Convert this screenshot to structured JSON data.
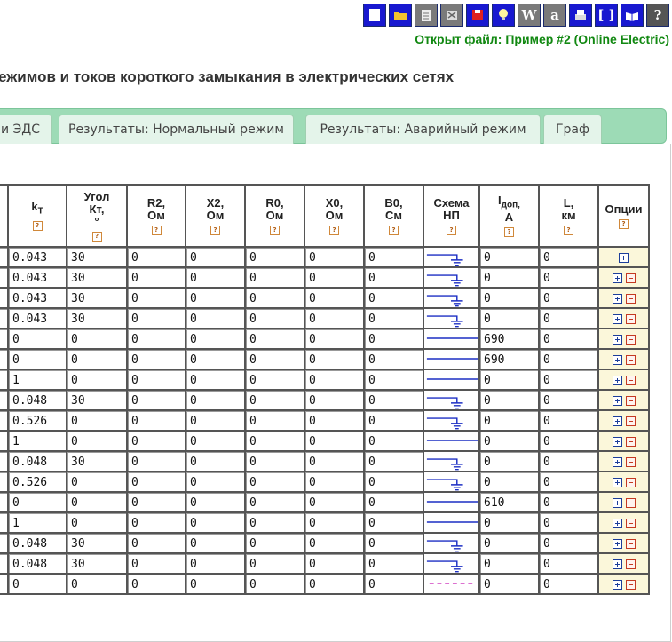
{
  "toolbar": {
    "buttons": [
      {
        "name": "new-file-icon",
        "color": "#1818d0"
      },
      {
        "name": "open-folder-icon",
        "color": "#1818d0"
      },
      {
        "name": "notepad-icon",
        "color": "#7a7a7a"
      },
      {
        "name": "close-file-icon",
        "color": "#7a7a7a"
      },
      {
        "name": "save-icon",
        "color": "#1818d0"
      },
      {
        "name": "lightbulb-icon",
        "color": "#1818d0"
      },
      {
        "name": "word-export-icon",
        "color": "#7a7a7a",
        "glyph": "W"
      },
      {
        "name": "text-export-icon",
        "color": "#7a7a7a",
        "glyph": "a"
      },
      {
        "name": "print-icon",
        "color": "#1818d0"
      },
      {
        "name": "brackets-icon",
        "color": "#1818d0",
        "glyph": "[ ]"
      },
      {
        "name": "manual-book-icon",
        "color": "#1818d0"
      },
      {
        "name": "help-icon",
        "color": "#555555",
        "glyph": "?"
      }
    ]
  },
  "file_status": "Открыт файл: Пример #2 (Online Electric)",
  "page_title": "ежимов и токов короткого замыкания в электрических сетях",
  "tabs": [
    {
      "label": "и ЭДС",
      "name": "tab-emf"
    },
    {
      "label": "Результаты: Нормальный режим",
      "name": "tab-results-normal"
    },
    {
      "label": "Результаты: Аварийный режим",
      "name": "tab-results-fault"
    },
    {
      "label": "Граф",
      "name": "tab-graph"
    }
  ],
  "table": {
    "headers": {
      "kt": {
        "main": "k",
        "sub": "T"
      },
      "angle": {
        "line1": "Угол",
        "line2": "Кт,",
        "line3": "°"
      },
      "r2": {
        "line1": "R2,",
        "line2": "Ом"
      },
      "x2": {
        "line1": "X2,",
        "line2": "Ом"
      },
      "r0": {
        "line1": "R0,",
        "line2": "Ом"
      },
      "x0": {
        "line1": "X0,",
        "line2": "Ом"
      },
      "b0": {
        "line1": "B0,",
        "line2": "См"
      },
      "scheme": {
        "line1": "Схема",
        "line2": "НП"
      },
      "idop": {
        "main": "I",
        "sub": "доп,",
        "line2": "А"
      },
      "l": {
        "line1": "L,",
        "line2": "км"
      },
      "options": "Опции"
    },
    "help_glyph": "?",
    "rows": [
      {
        "kt": "0.043",
        "angle": "30",
        "r2": "0",
        "x2": "0",
        "r0": "0",
        "x0": "0",
        "b0": "0",
        "scheme": "ground",
        "idop": "0",
        "l": "0",
        "minus": false
      },
      {
        "kt": "0.043",
        "angle": "30",
        "r2": "0",
        "x2": "0",
        "r0": "0",
        "x0": "0",
        "b0": "0",
        "scheme": "ground",
        "idop": "0",
        "l": "0",
        "minus": true
      },
      {
        "kt": "0.043",
        "angle": "30",
        "r2": "0",
        "x2": "0",
        "r0": "0",
        "x0": "0",
        "b0": "0",
        "scheme": "ground",
        "idop": "0",
        "l": "0",
        "minus": true
      },
      {
        "kt": "0.043",
        "angle": "30",
        "r2": "0",
        "x2": "0",
        "r0": "0",
        "x0": "0",
        "b0": "0",
        "scheme": "ground",
        "idop": "0",
        "l": "0",
        "minus": true
      },
      {
        "kt": "0",
        "angle": "0",
        "r2": "0",
        "x2": "0",
        "r0": "0",
        "x0": "0",
        "b0": "0",
        "scheme": "line",
        "idop": "690",
        "l": "0",
        "minus": true
      },
      {
        "kt": "0",
        "angle": "0",
        "r2": "0",
        "x2": "0",
        "r0": "0",
        "x0": "0",
        "b0": "0",
        "scheme": "line",
        "idop": "690",
        "l": "0",
        "minus": true
      },
      {
        "kt": "1",
        "angle": "0",
        "r2": "0",
        "x2": "0",
        "r0": "0",
        "x0": "0",
        "b0": "0",
        "scheme": "line",
        "idop": "0",
        "l": "0",
        "minus": true
      },
      {
        "kt": "0.048",
        "angle": "30",
        "r2": "0",
        "x2": "0",
        "r0": "0",
        "x0": "0",
        "b0": "0",
        "scheme": "ground",
        "idop": "0",
        "l": "0",
        "minus": true
      },
      {
        "kt": "0.526",
        "angle": "0",
        "r2": "0",
        "x2": "0",
        "r0": "0",
        "x0": "0",
        "b0": "0",
        "scheme": "ground",
        "idop": "0",
        "l": "0",
        "minus": true
      },
      {
        "kt": "1",
        "angle": "0",
        "r2": "0",
        "x2": "0",
        "r0": "0",
        "x0": "0",
        "b0": "0",
        "scheme": "line",
        "idop": "0",
        "l": "0",
        "minus": true
      },
      {
        "kt": "0.048",
        "angle": "30",
        "r2": "0",
        "x2": "0",
        "r0": "0",
        "x0": "0",
        "b0": "0",
        "scheme": "ground",
        "idop": "0",
        "l": "0",
        "minus": true
      },
      {
        "kt": "0.526",
        "angle": "0",
        "r2": "0",
        "x2": "0",
        "r0": "0",
        "x0": "0",
        "b0": "0",
        "scheme": "ground",
        "idop": "0",
        "l": "0",
        "minus": true
      },
      {
        "kt": "0",
        "angle": "0",
        "r2": "0",
        "x2": "0",
        "r0": "0",
        "x0": "0",
        "b0": "0",
        "scheme": "line",
        "idop": "610",
        "l": "0",
        "minus": true
      },
      {
        "kt": "1",
        "angle": "0",
        "r2": "0",
        "x2": "0",
        "r0": "0",
        "x0": "0",
        "b0": "0",
        "scheme": "line",
        "idop": "0",
        "l": "0",
        "minus": true
      },
      {
        "kt": "0.048",
        "angle": "30",
        "r2": "0",
        "x2": "0",
        "r0": "0",
        "x0": "0",
        "b0": "0",
        "scheme": "ground",
        "idop": "0",
        "l": "0",
        "minus": true
      },
      {
        "kt": "0.048",
        "angle": "30",
        "r2": "0",
        "x2": "0",
        "r0": "0",
        "x0": "0",
        "b0": "0",
        "scheme": "ground",
        "idop": "0",
        "l": "0",
        "minus": true
      },
      {
        "kt": "0",
        "angle": "0",
        "r2": "0",
        "x2": "0",
        "r0": "0",
        "x0": "0",
        "b0": "0",
        "scheme": "dashed",
        "idop": "0",
        "l": "0",
        "minus": true
      }
    ]
  },
  "colors": {
    "scheme_line": "#1c2fc4",
    "scheme_dashed": "#d040c0",
    "tab_strip": "#9ddbb6",
    "file_status": "#118811"
  }
}
